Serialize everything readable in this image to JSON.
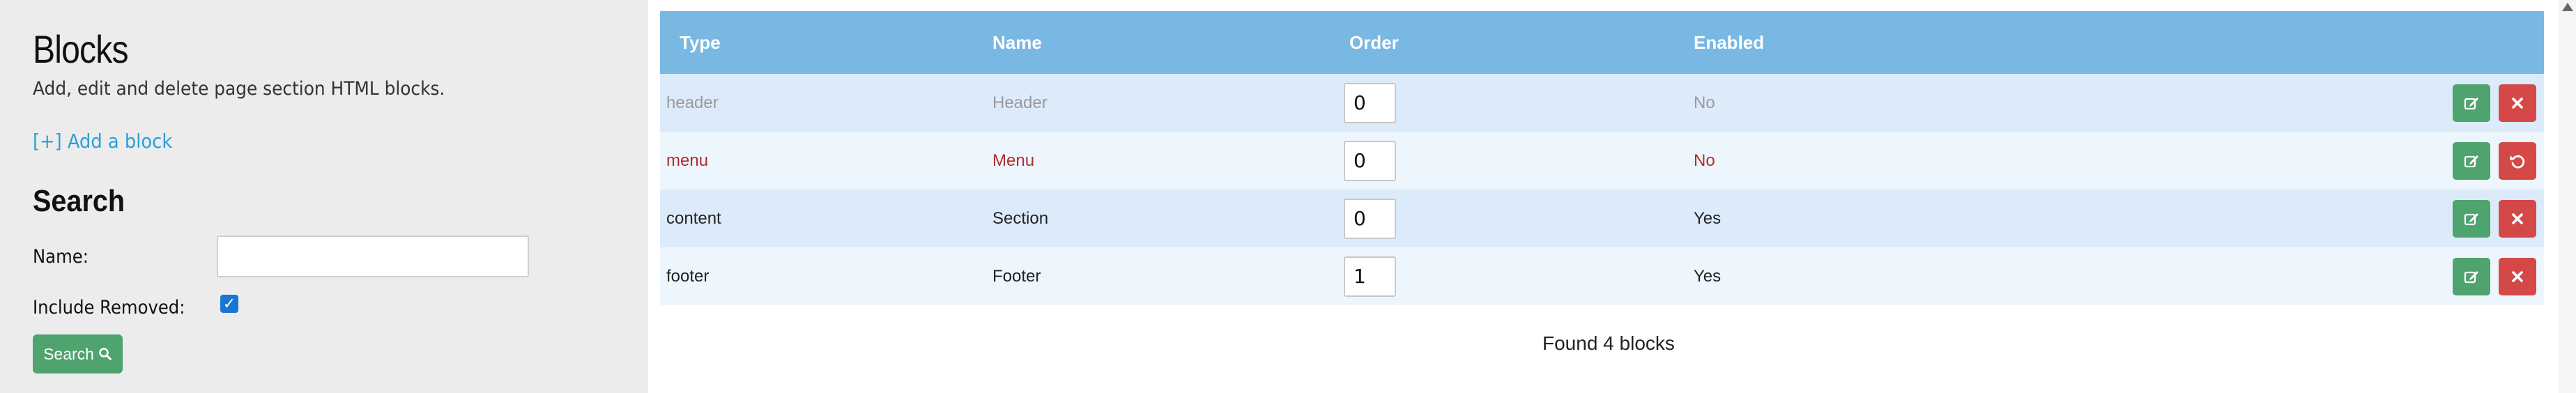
{
  "sidebar": {
    "title": "Blocks",
    "description": "Add, edit and delete page section HTML blocks.",
    "add_link": "[+] Add a block",
    "search_heading": "Search",
    "name_label": "Name:",
    "name_value": "",
    "include_removed_label": "Include Removed:",
    "include_removed_checked": true,
    "search_button": "Search",
    "search_button_icon": "search-icon"
  },
  "table": {
    "headers": {
      "type": "Type",
      "name": "Name",
      "order": "Order",
      "enabled": "Enabled"
    },
    "rows": [
      {
        "type": "header",
        "name": "Header",
        "order": "0",
        "enabled": "No",
        "state": "disabled",
        "secondary_action": "delete-icon"
      },
      {
        "type": "menu",
        "name": "Menu",
        "order": "0",
        "enabled": "No",
        "state": "removed",
        "secondary_action": "restore-icon"
      },
      {
        "type": "content",
        "name": "Section",
        "order": "0",
        "enabled": "Yes",
        "state": "normal",
        "secondary_action": "delete-icon"
      },
      {
        "type": "footer",
        "name": "Footer",
        "order": "1",
        "enabled": "Yes",
        "state": "normal",
        "secondary_action": "delete-icon"
      }
    ]
  },
  "footer": {
    "found_text": "Found 4 blocks"
  },
  "colors": {
    "header_bg": "#7ab8e4",
    "row_odd": "#dcebfa",
    "row_even": "#eef6fd",
    "edit_button": "#4ea36f",
    "delete_button": "#d54848",
    "link": "#2a9fd6",
    "removed_text": "#b12c2c",
    "disabled_text": "#9a9a9a"
  }
}
